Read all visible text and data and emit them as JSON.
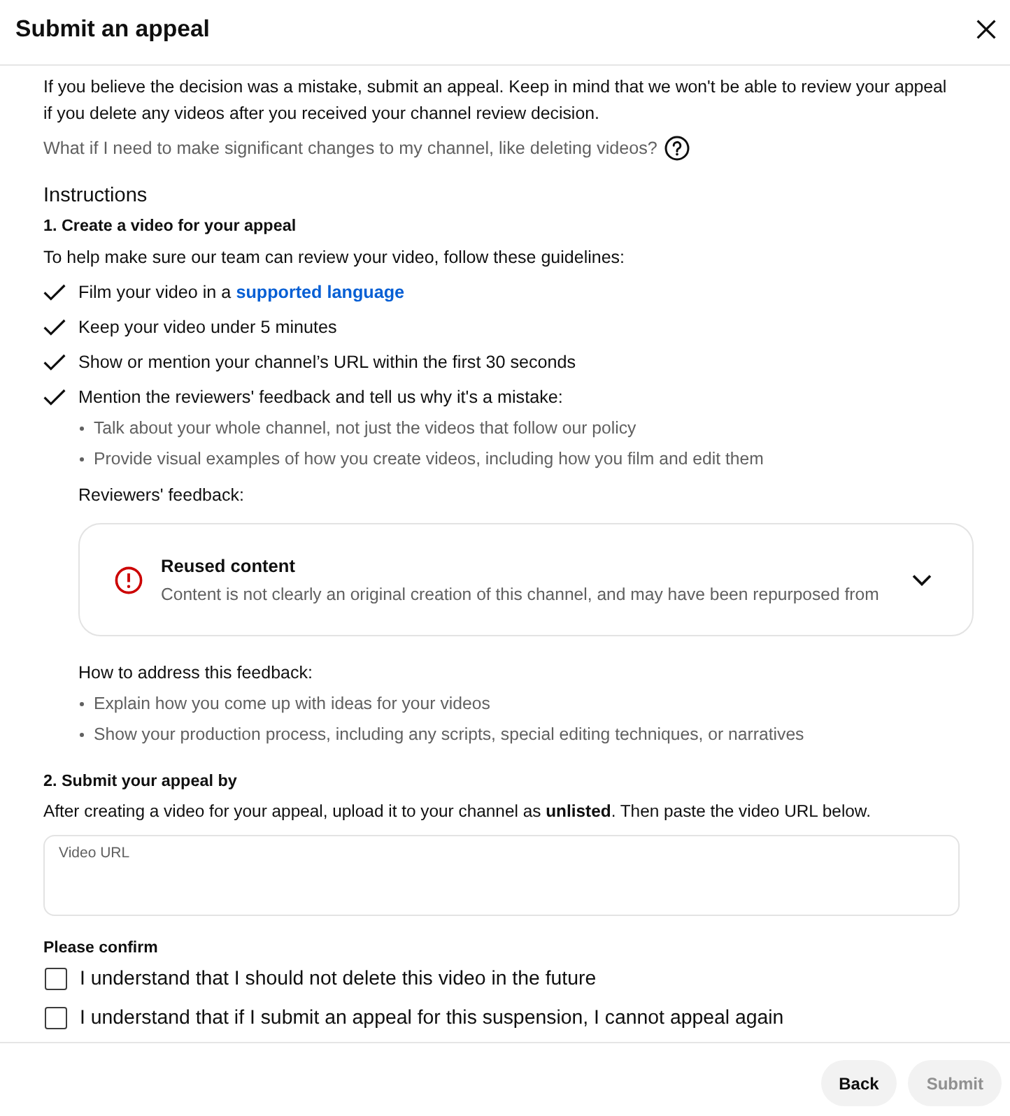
{
  "dialog": {
    "title": "Submit an appeal"
  },
  "intro": {
    "text": "If you believe the decision was a mistake, submit an appeal. Keep in mind that we won't be able to review your appeal if you delete any videos after you received your channel review decision.",
    "help_question": "What if I need to make significant changes to my channel, like deleting videos?"
  },
  "instructions": {
    "heading": "Instructions",
    "step_1": {
      "title": "1. Create a video for your appeal",
      "lead": "To help make sure our team can review your video, follow these guidelines:",
      "guidelines": [
        {
          "text": "Film your video in a",
          "link": "supported language"
        },
        {
          "text": "Keep your video under 5 minutes"
        },
        {
          "text": "Show or mention your channel’s URL within the first 30 seconds"
        },
        {
          "text": "Mention the reviewers' feedback and tell us why it's a mistake:",
          "points": [
            "Talk about your whole channel, not just the videos that follow our policy",
            "Provide visual examples of how you create videos, including how you film and edit them"
          ]
        }
      ],
      "feedback_label": "Reviewers' feedback:",
      "feedback": [
        {
          "title": "Reused content",
          "description": "Content is not clearly an original creation of this channel, and may have been repurposed from",
          "expanded": false
        }
      ],
      "address_label": "How to address this feedback:",
      "address_points": [
        "Explain how you come up with ideas for your videos",
        "Show your production process, including any scripts, special editing techniques, or narratives"
      ]
    },
    "step_2": {
      "title": "2. Submit your appeal by",
      "text": "After creating a video for your appeal, upload it to your channel as **unlisted**. Then paste the video URL below.",
      "video_url": {
        "label": "Video URL"
      }
    }
  },
  "confirm": {
    "heading": "Please confirm",
    "items": [
      {
        "text": "I understand that I should not delete this video in the future",
        "checked": false
      },
      {
        "text": "I understand that if I submit an appeal for this suspension, I cannot appeal again",
        "checked": false
      }
    ]
  },
  "buttons": [
    {
      "label": "Back",
      "disabled": false
    },
    {
      "label": "Submit",
      "disabled": true
    }
  ]
}
